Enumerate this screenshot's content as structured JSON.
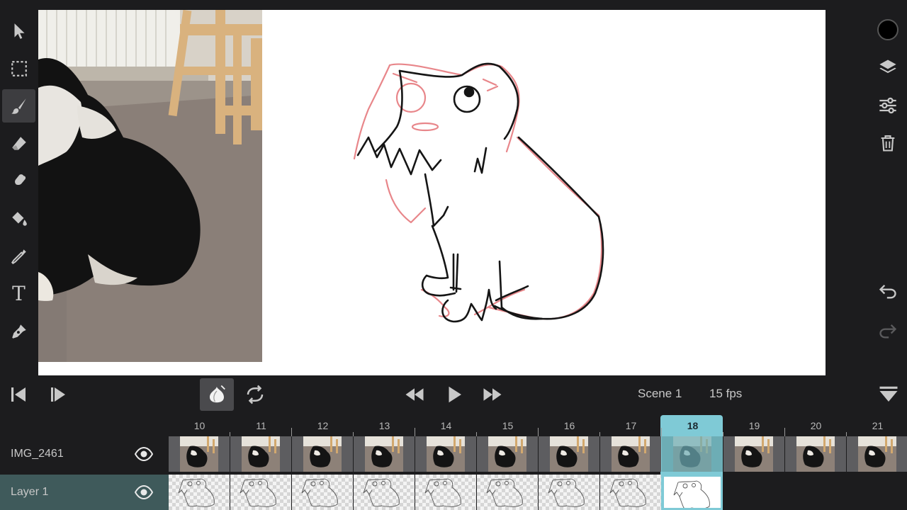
{
  "toolbar_left": {
    "tools": [
      {
        "name": "select-arrow-icon",
        "active": false
      },
      {
        "name": "marquee-select-icon",
        "active": false
      },
      {
        "name": "brush-icon",
        "active": true
      },
      {
        "name": "eraser-icon",
        "active": false
      },
      {
        "name": "smudge-icon",
        "active": false
      },
      {
        "name": "paint-bucket-icon",
        "active": false
      },
      {
        "name": "eyedropper-icon",
        "active": false
      },
      {
        "name": "text-icon",
        "active": false,
        "glyph": "T"
      },
      {
        "name": "pen-nib-icon",
        "active": false
      }
    ]
  },
  "toolbar_right": {
    "color": "#000000",
    "tools": [
      "color-swatch",
      "layers-icon",
      "adjustments-icon",
      "trash-icon",
      "undo-icon",
      "redo-icon"
    ]
  },
  "playback": {
    "scene_label": "Scene 1",
    "fps_label": "15 fps",
    "onion_skin_active": true
  },
  "timeline": {
    "frames": [
      "10",
      "11",
      "12",
      "13",
      "14",
      "15",
      "16",
      "17",
      "18",
      "19",
      "20",
      "21"
    ],
    "current_frame": "18",
    "layers": [
      {
        "name": "IMG_2461",
        "visible": true,
        "selected": false
      },
      {
        "name": "Layer 1",
        "visible": true,
        "selected": true
      }
    ]
  },
  "colors": {
    "accent": "#7fcad6",
    "selected_layer": "#3f5a5b",
    "background": "#1c1c1e",
    "onion_skin": "#e8868a"
  }
}
